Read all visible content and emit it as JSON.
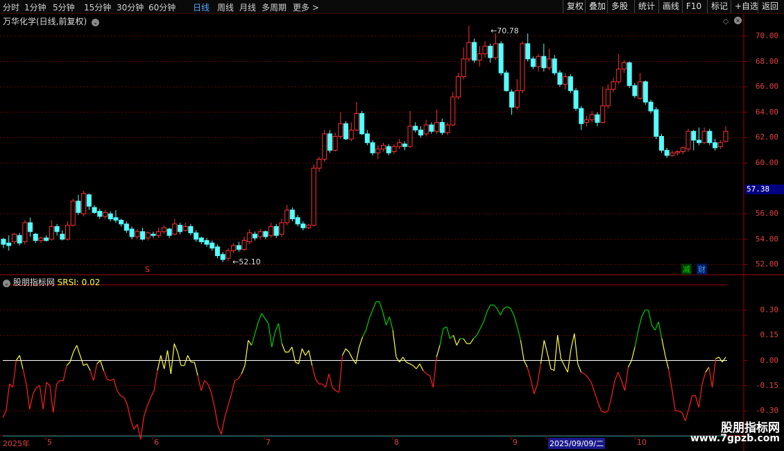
{
  "toolbar": {
    "left": [
      "分时",
      "1分钟",
      "5分钟",
      "15分钟",
      "30分钟",
      "60分钟",
      "日线",
      "周线",
      "月线",
      "多周期",
      "更多 >"
    ],
    "active": "日线",
    "right": [
      "复权",
      "叠加",
      "多股",
      "统计",
      "画线",
      "F10",
      "标记",
      "+自选",
      "返回"
    ]
  },
  "stock_title": "万华化学(日线,前复权)",
  "price_axis": [
    "70.00",
    "68.00",
    "66.00",
    "64.00",
    "62.00",
    "60.00",
    "56.00",
    "54.00",
    "52.00"
  ],
  "current_price": "57.38",
  "high_label": "70.78",
  "low_label": "52.10",
  "indicator_title": "股朋指标网",
  "indicator_name": "SRSI: 0.02",
  "ind_axis": [
    "0.30",
    "0.15",
    "0.00",
    "-0.15",
    "-0.30"
  ],
  "x_labels": [
    "2025年",
    "5",
    "6",
    "7",
    "8",
    "9",
    "2025/09/09/二",
    "10"
  ],
  "marker_s": "S",
  "badge_jian": "减",
  "badge_cai": "财",
  "watermark": {
    "line1": "股朋指标网",
    "line2": "www.7gpzb.com"
  },
  "colors": {
    "up": "#ff3232",
    "down": "#54ffff",
    "srsi_up": "#00d000",
    "srsi_mid": "#ffff40",
    "srsi_down": "#ff2020",
    "zero": "#ffffff",
    "lower": "#00a0a0",
    "upper": "#a00000"
  },
  "chart_data": {
    "type": "candlestick",
    "price_ylim": [
      51.2,
      71.2
    ],
    "candles": [
      [
        54.0,
        53.6,
        54.1,
        53.3
      ],
      [
        53.7,
        53.5,
        54.3,
        53.1
      ],
      [
        53.8,
        54.4,
        54.5,
        53.6
      ],
      [
        54.3,
        53.7,
        54.5,
        53.5
      ],
      [
        53.8,
        55.3,
        55.5,
        53.6
      ],
      [
        55.3,
        54.6,
        55.7,
        54.2
      ],
      [
        54.4,
        53.9,
        54.5,
        53.7
      ],
      [
        53.9,
        54.1,
        54.2,
        53.7
      ],
      [
        54.1,
        53.9,
        54.3,
        53.8
      ],
      [
        54.0,
        55.0,
        55.5,
        53.9
      ],
      [
        55.0,
        54.6,
        55.2,
        54.3
      ],
      [
        54.4,
        54.0,
        54.7,
        53.9
      ],
      [
        54.0,
        55.1,
        55.4,
        53.9
      ],
      [
        55.1,
        57.0,
        57.2,
        55.0
      ],
      [
        57.0,
        56.1,
        57.5,
        55.9
      ],
      [
        56.0,
        57.6,
        57.8,
        55.8
      ],
      [
        57.5,
        56.6,
        57.6,
        56.3
      ],
      [
        56.5,
        56.1,
        56.7,
        56.0
      ],
      [
        56.2,
        55.8,
        56.4,
        55.6
      ],
      [
        55.8,
        56.1,
        56.3,
        55.6
      ],
      [
        56.0,
        55.6,
        56.2,
        55.4
      ],
      [
        55.7,
        55.5,
        56.3,
        55.3
      ],
      [
        55.5,
        55.2,
        55.6,
        55.0
      ],
      [
        55.2,
        54.7,
        55.4,
        54.5
      ],
      [
        54.8,
        54.2,
        55.0,
        54.0
      ],
      [
        54.2,
        54.6,
        54.8,
        54.0
      ],
      [
        54.6,
        54.0,
        54.9,
        53.9
      ],
      [
        54.1,
        54.5,
        54.6,
        53.9
      ],
      [
        54.4,
        54.3,
        54.6,
        54.1
      ],
      [
        54.3,
        54.6,
        54.9,
        54.1
      ],
      [
        54.6,
        54.9,
        55.1,
        54.4
      ],
      [
        54.8,
        54.3,
        54.9,
        54.1
      ],
      [
        54.4,
        55.2,
        55.6,
        54.3
      ],
      [
        55.1,
        54.6,
        55.3,
        54.4
      ],
      [
        54.7,
        55.0,
        55.3,
        54.6
      ],
      [
        55.0,
        54.5,
        55.2,
        54.3
      ],
      [
        54.5,
        54.0,
        54.7,
        53.8
      ],
      [
        54.1,
        53.8,
        54.2,
        53.6
      ],
      [
        53.9,
        53.6,
        54.1,
        53.4
      ],
      [
        53.7,
        53.3,
        53.9,
        53.1
      ],
      [
        53.4,
        52.7,
        53.6,
        52.5
      ],
      [
        52.8,
        52.4,
        53.0,
        52.2
      ],
      [
        52.5,
        53.1,
        53.3,
        52.3
      ],
      [
        53.1,
        53.5,
        53.7,
        52.9
      ],
      [
        53.5,
        53.2,
        53.8,
        53.0
      ],
      [
        53.2,
        53.9,
        54.2,
        53.1
      ],
      [
        53.8,
        54.5,
        54.8,
        53.6
      ],
      [
        54.4,
        54.1,
        54.6,
        53.9
      ],
      [
        54.2,
        54.6,
        54.8,
        54.0
      ],
      [
        54.6,
        54.2,
        54.7,
        54.0
      ],
      [
        54.3,
        55.0,
        55.3,
        54.1
      ],
      [
        55.0,
        54.3,
        55.2,
        54.1
      ],
      [
        54.4,
        55.3,
        55.6,
        54.2
      ],
      [
        55.3,
        56.3,
        56.7,
        55.1
      ],
      [
        56.3,
        55.6,
        56.5,
        55.4
      ],
      [
        55.7,
        55.2,
        55.9,
        55.0
      ],
      [
        55.2,
        54.9,
        55.4,
        54.7
      ],
      [
        54.9,
        55.1,
        55.2,
        54.8
      ],
      [
        55.1,
        59.6,
        59.9,
        55.0
      ],
      [
        59.6,
        60.3,
        60.5,
        59.3
      ],
      [
        60.3,
        62.3,
        62.6,
        60.1
      ],
      [
        62.3,
        61.0,
        62.6,
        60.8
      ],
      [
        61.0,
        62.1,
        62.4,
        60.9
      ],
      [
        62.1,
        63.1,
        64.0,
        61.9
      ],
      [
        63.1,
        61.9,
        63.3,
        61.8
      ],
      [
        61.9,
        62.6,
        63.2,
        61.7
      ],
      [
        62.6,
        63.9,
        64.8,
        62.5
      ],
      [
        63.9,
        62.3,
        64.1,
        62.2
      ],
      [
        62.3,
        61.6,
        62.6,
        61.4
      ],
      [
        61.6,
        60.8,
        61.8,
        60.6
      ],
      [
        60.8,
        61.1,
        61.4,
        60.3
      ],
      [
        61.1,
        61.4,
        61.6,
        60.9
      ],
      [
        61.3,
        60.8,
        61.5,
        60.6
      ],
      [
        60.9,
        61.3,
        61.5,
        60.7
      ],
      [
        61.3,
        61.6,
        61.9,
        61.1
      ],
      [
        61.5,
        61.3,
        61.7,
        61.0
      ],
      [
        61.3,
        62.9,
        64.1,
        61.2
      ],
      [
        62.9,
        62.6,
        63.2,
        62.4
      ],
      [
        62.6,
        62.2,
        62.9,
        62.0
      ],
      [
        62.3,
        63.0,
        63.4,
        62.1
      ],
      [
        63.0,
        62.5,
        63.2,
        62.3
      ],
      [
        62.5,
        63.2,
        64.2,
        62.3
      ],
      [
        63.2,
        62.4,
        63.5,
        62.2
      ],
      [
        62.4,
        63.0,
        63.2,
        62.2
      ],
      [
        63.0,
        65.2,
        65.6,
        62.9
      ],
      [
        65.2,
        66.8,
        67.1,
        65.0
      ],
      [
        66.8,
        68.2,
        69.1,
        66.6
      ],
      [
        68.2,
        69.5,
        70.8,
        68.0
      ],
      [
        69.5,
        68.1,
        69.8,
        67.9
      ],
      [
        68.1,
        68.6,
        69.2,
        67.6
      ],
      [
        68.6,
        69.2,
        69.6,
        68.3
      ],
      [
        69.2,
        68.3,
        69.4,
        67.9
      ],
      [
        68.3,
        69.4,
        70.2,
        68.1
      ],
      [
        69.4,
        67.1,
        69.6,
        66.9
      ],
      [
        67.1,
        65.7,
        67.3,
        65.6
      ],
      [
        65.6,
        64.4,
        65.8,
        63.8
      ],
      [
        64.4,
        65.7,
        66.6,
        64.2
      ],
      [
        65.7,
        69.4,
        69.6,
        65.5
      ],
      [
        69.4,
        68.2,
        70.2,
        68.0
      ],
      [
        68.2,
        67.6,
        68.4,
        67.4
      ],
      [
        67.6,
        68.4,
        68.6,
        67.2
      ],
      [
        68.4,
        67.5,
        69.4,
        67.2
      ],
      [
        67.5,
        68.2,
        69.0,
        67.3
      ],
      [
        68.2,
        67.1,
        68.5,
        66.9
      ],
      [
        67.1,
        66.2,
        67.3,
        66.0
      ],
      [
        66.2,
        66.8,
        67.1,
        65.8
      ],
      [
        66.8,
        65.7,
        67.0,
        65.5
      ],
      [
        65.7,
        64.3,
        65.9,
        64.1
      ],
      [
        64.3,
        63.1,
        64.5,
        62.6
      ],
      [
        63.2,
        63.4,
        63.7,
        62.9
      ],
      [
        63.4,
        63.8,
        64.1,
        63.2
      ],
      [
        63.8,
        63.2,
        64.0,
        62.9
      ],
      [
        63.2,
        64.5,
        66.0,
        63.1
      ],
      [
        64.5,
        65.8,
        66.2,
        64.3
      ],
      [
        65.8,
        66.4,
        66.7,
        65.6
      ],
      [
        66.4,
        67.4,
        68.6,
        66.2
      ],
      [
        67.4,
        67.9,
        68.1,
        67.1
      ],
      [
        67.9,
        66.1,
        68.0,
        65.9
      ],
      [
        66.1,
        65.3,
        66.3,
        65.1
      ],
      [
        65.1,
        66.4,
        67.1,
        65.0
      ],
      [
        66.4,
        64.8,
        66.5,
        64.6
      ],
      [
        64.8,
        64.1,
        65.0,
        63.9
      ],
      [
        64.2,
        62.1,
        64.4,
        61.9
      ],
      [
        62.1,
        61.0,
        62.3,
        60.8
      ],
      [
        61.0,
        60.6,
        61.2,
        60.4
      ],
      [
        60.6,
        60.8,
        61.0,
        60.5
      ],
      [
        60.8,
        60.9,
        61.0,
        60.6
      ],
      [
        60.9,
        61.2,
        61.3,
        60.7
      ],
      [
        61.1,
        62.5,
        62.7,
        60.9
      ],
      [
        62.5,
        61.8,
        62.6,
        61.0
      ],
      [
        61.8,
        61.6,
        62.8,
        61.4
      ],
      [
        61.6,
        62.5,
        62.8,
        61.5
      ],
      [
        62.5,
        61.6,
        62.7,
        61.4
      ],
      [
        61.6,
        61.2,
        61.9,
        61.0
      ],
      [
        61.3,
        61.6,
        61.8,
        61.1
      ],
      [
        61.7,
        62.5,
        62.9,
        61.6
      ]
    ],
    "ind_ylim": [
      -0.44,
      0.44
    ],
    "srsi": [
      -0.34,
      -0.3,
      -0.14,
      -0.16,
      0.0,
      0.03,
      -0.05,
      -0.14,
      -0.29,
      -0.2,
      -0.16,
      -0.15,
      -0.29,
      -0.13,
      -0.15,
      -0.31,
      -0.14,
      -0.12,
      -0.12,
      -0.03,
      -0.01,
      0.05,
      0.09,
      0.03,
      -0.03,
      -0.02,
      -0.06,
      -0.12,
      -0.02,
      0.0,
      -0.06,
      -0.11,
      -0.12,
      -0.11,
      -0.18,
      -0.21,
      -0.22,
      -0.26,
      -0.35,
      -0.41,
      -0.38,
      -0.47,
      -0.33,
      -0.27,
      -0.22,
      -0.18,
      -0.06,
      0.03,
      -0.05,
      0.06,
      -0.08,
      0.1,
      0.05,
      -0.03,
      -0.03,
      0.03,
      -0.01,
      -0.01,
      -0.09,
      -0.18,
      -0.12,
      -0.14,
      -0.19,
      -0.28,
      -0.39,
      -0.44,
      -0.34,
      -0.27,
      -0.2,
      -0.12,
      -0.11,
      -0.08,
      -0.03,
      0.12,
      0.09,
      0.16,
      0.23,
      0.28,
      0.25,
      0.22,
      0.08,
      0.17,
      0.22,
      0.1,
      0.05,
      0.05,
      0.08,
      -0.01,
      -0.02,
      0.07,
      0.03,
      0.06,
      -0.03,
      -0.11,
      -0.14,
      -0.14,
      -0.16,
      -0.08,
      -0.16,
      -0.18,
      -0.19,
      0.03,
      0.07,
      0.05,
      0.01,
      -0.02,
      0.08,
      0.14,
      0.18,
      0.25,
      0.3,
      0.35,
      0.35,
      0.29,
      0.21,
      0.26,
      0.18,
      0.02,
      -0.01,
      0.02,
      -0.01,
      -0.02,
      -0.03,
      -0.05,
      -0.02,
      -0.06,
      -0.08,
      -0.09,
      -0.16,
      0.02,
      0.09,
      0.19,
      0.2,
      0.13,
      0.15,
      0.09,
      0.13,
      0.13,
      0.1,
      0.1,
      0.13,
      0.15,
      0.19,
      0.23,
      0.29,
      0.33,
      0.33,
      0.31,
      0.27,
      0.31,
      0.32,
      0.31,
      0.27,
      0.2,
      0.12,
      0.0,
      -0.04,
      -0.11,
      -0.2,
      -0.14,
      -0.02,
      0.12,
      0.04,
      -0.05,
      -0.06,
      0.15,
      0.01,
      -0.03,
      -0.07,
      0.07,
      0.16,
      -0.02,
      -0.07,
      -0.08,
      -0.1,
      -0.13,
      -0.19,
      -0.25,
      -0.3,
      -0.31,
      -0.3,
      -0.22,
      -0.12,
      -0.07,
      -0.12,
      -0.18,
      -0.04,
      0.0,
      0.08,
      0.18,
      0.26,
      0.3,
      0.3,
      0.21,
      0.18,
      0.23,
      0.13,
      0.03,
      -0.05,
      -0.17,
      -0.3,
      -0.3,
      -0.31,
      -0.36,
      -0.29,
      -0.21,
      -0.21,
      -0.28,
      -0.14,
      -0.07,
      -0.04,
      -0.16,
      0.01,
      0.02,
      -0.01,
      0.02
    ]
  }
}
